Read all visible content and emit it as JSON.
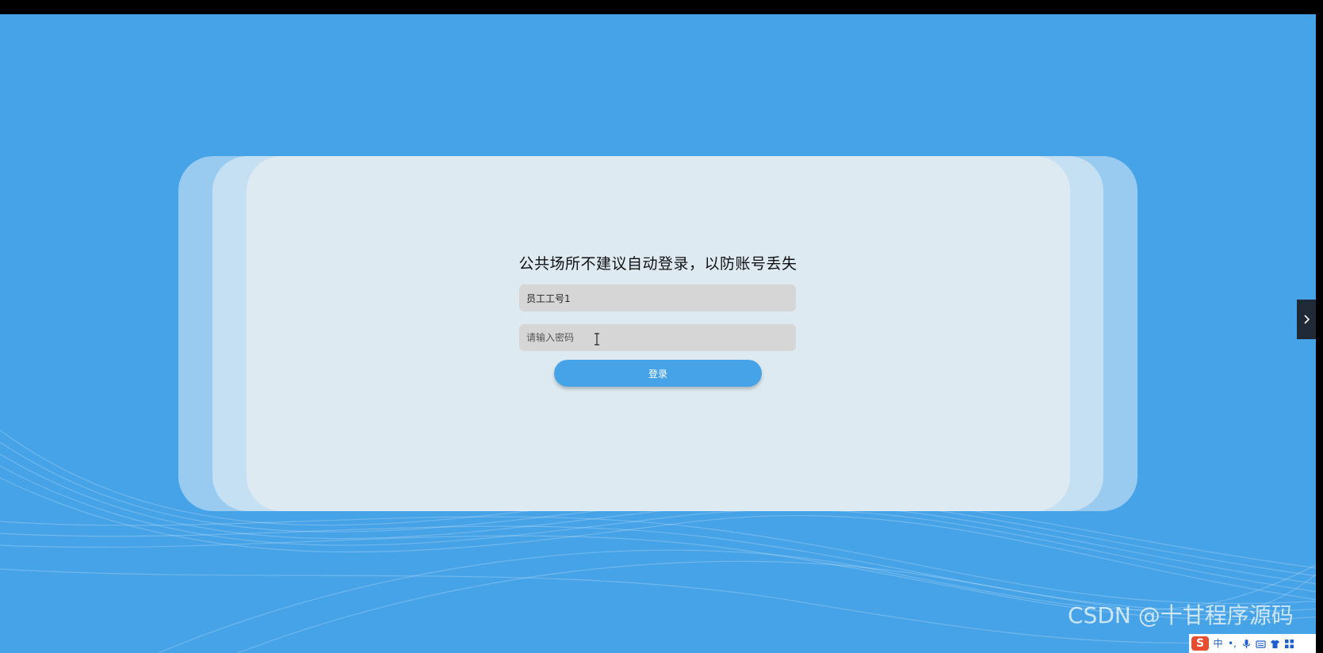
{
  "login": {
    "title": "公共场所不建议自动登录，以防账号丢失",
    "username_value": "员工工号1",
    "password_placeholder": "请输入密码",
    "submit_label": "登录"
  },
  "watermark": "CSDN @十甘程序源码",
  "ime_toolbar": {
    "logo": "S",
    "mode": "中",
    "punct": "•,"
  },
  "colors": {
    "background": "#47a3e7",
    "card": "#deeaf1",
    "input": "#d6d6d6",
    "button": "#47a3e7"
  }
}
